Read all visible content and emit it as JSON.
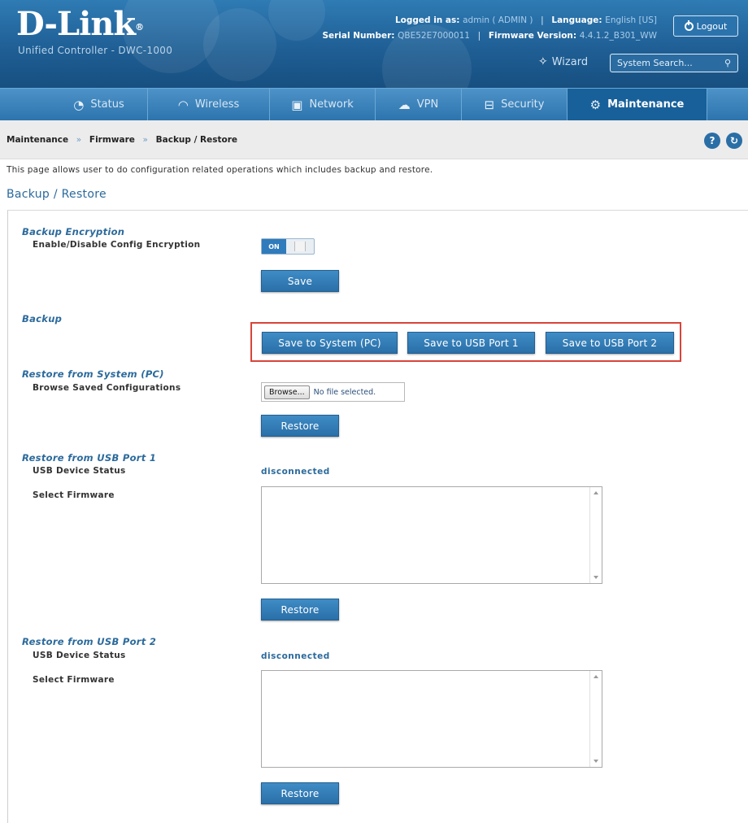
{
  "header": {
    "logo": "D-Link",
    "logo_mark": "®",
    "subtitle": "Unified Controller - DWC-1000",
    "logged_in_label": "Logged in as:",
    "logged_in_value": "admin ( ADMIN )",
    "language_label": "Language:",
    "language_value": "English [US]",
    "serial_label": "Serial Number:",
    "serial_value": "QBE52E7000011",
    "firmware_label": "Firmware Version:",
    "firmware_value": "4.4.1.2_B301_WW",
    "logout_label": "Logout",
    "wizard_label": "Wizard",
    "search_placeholder": "System Search..."
  },
  "nav": {
    "items": [
      {
        "label": "Status",
        "icon": "gauge-icon"
      },
      {
        "label": "Wireless",
        "icon": "wifi-icon"
      },
      {
        "label": "Network",
        "icon": "monitor-icon"
      },
      {
        "label": "VPN",
        "icon": "cloud-lock-icon"
      },
      {
        "label": "Security",
        "icon": "lock-icon"
      },
      {
        "label": "Maintenance",
        "icon": "gear-icon"
      }
    ],
    "active": "Maintenance"
  },
  "breadcrumb": {
    "items": [
      "Maintenance",
      "Firmware",
      "Backup / Restore"
    ],
    "separator": "»"
  },
  "page": {
    "description": "This page allows user to do configuration related operations which includes backup and restore.",
    "title": "Backup / Restore"
  },
  "backup_encryption": {
    "title": "Backup Encryption",
    "label": "Enable/Disable Config Encryption",
    "toggle_state": "ON",
    "save_label": "Save"
  },
  "backup": {
    "title": "Backup",
    "buttons": [
      "Save to System (PC)",
      "Save to USB Port 1",
      "Save to USB Port 2"
    ]
  },
  "restore_pc": {
    "title": "Restore from System (PC)",
    "label": "Browse Saved Configurations",
    "browse_label": "Browse...",
    "file_status": "No file selected.",
    "restore_label": "Restore"
  },
  "restore_usb1": {
    "title": "Restore from USB Port 1",
    "status_label": "USB Device Status",
    "status_value": "disconnected",
    "firmware_label": "Select Firmware",
    "restore_label": "Restore"
  },
  "restore_usb2": {
    "title": "Restore from USB Port 2",
    "status_label": "USB Device Status",
    "status_value": "disconnected",
    "firmware_label": "Select Firmware",
    "restore_label": "Restore"
  }
}
